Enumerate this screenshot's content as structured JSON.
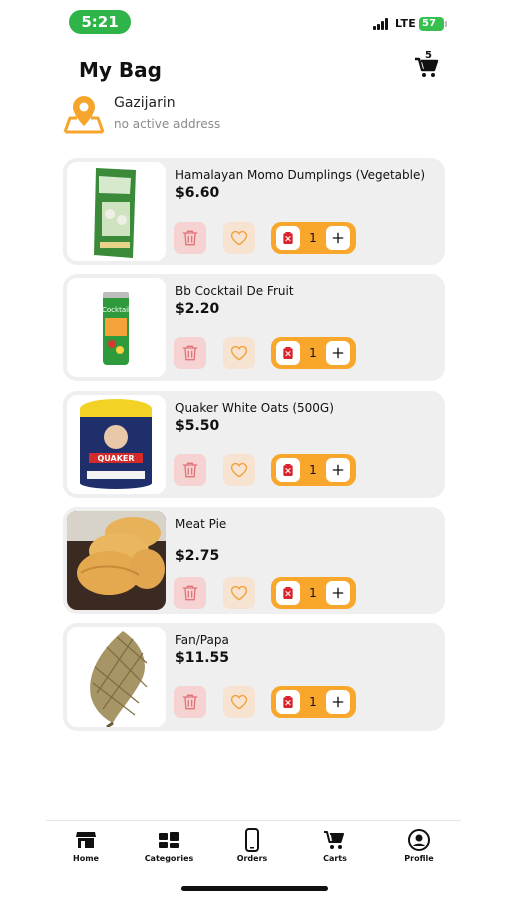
{
  "status_bar": {
    "time": "5:21",
    "network": "LTE",
    "battery": "57"
  },
  "header": {
    "title": "My Bag",
    "cart_count": "5",
    "cart_icon": "cart-icon"
  },
  "address": {
    "name": "Gazijarin",
    "status": "no active address",
    "icon": "location-pin-icon"
  },
  "items": [
    {
      "name": "Hamalayan Momo Dumplings (Vegetable)",
      "price": "$6.60",
      "quantity": "1",
      "image_icon": "momo-package-image"
    },
    {
      "name": "Bb Cocktail De Fruit",
      "price": "$2.20",
      "quantity": "1",
      "image_icon": "drink-can-image"
    },
    {
      "name": "Quaker White Oats (500G)",
      "price": "$5.50",
      "quantity": "1",
      "image_icon": "oats-tin-image"
    },
    {
      "name": "Meat Pie",
      "price": "$2.75",
      "quantity": "1",
      "image_icon": "meat-pie-image"
    },
    {
      "name": "Fan/Papa",
      "price": "$11.55",
      "quantity": "1",
      "image_icon": "hand-fan-image"
    }
  ],
  "nav": [
    {
      "label": "Home",
      "icon": "store-icon"
    },
    {
      "label": "Categories",
      "icon": "categories-icon"
    },
    {
      "label": "Orders",
      "icon": "phone-icon"
    },
    {
      "label": "Carts",
      "icon": "cart-icon"
    },
    {
      "label": "Profile",
      "icon": "profile-icon"
    }
  ],
  "colors": {
    "accent": "#f8a72c",
    "card": "#efefef",
    "delete_bg": "#f6d2d2",
    "delete": "#e06b6b",
    "fav_bg": "#f7e3d1",
    "time_pill": "#2fb44a"
  }
}
